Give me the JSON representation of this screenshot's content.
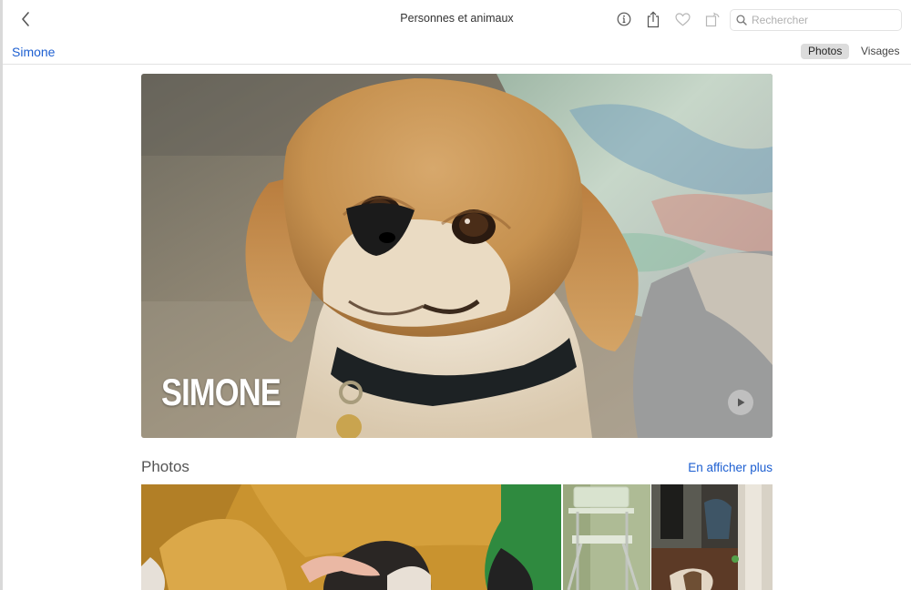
{
  "toolbar": {
    "title": "Personnes et animaux",
    "search_placeholder": "Rechercher",
    "icons": [
      "chevron-left-icon",
      "info-icon",
      "share-icon",
      "heart-icon",
      "rotate-icon",
      "search-icon"
    ]
  },
  "subheader": {
    "person_name": "Simone",
    "segments": [
      "Photos",
      "Visages"
    ],
    "selected_segment": "Photos"
  },
  "hero": {
    "title": "SIMONE",
    "play_icon": "play-icon"
  },
  "section": {
    "title": "Photos",
    "show_more": "En afficher plus"
  },
  "colors": {
    "accent": "#1d5fd1",
    "segment_active_bg": "#dcdcdc",
    "divider": "#e2e2e2"
  }
}
